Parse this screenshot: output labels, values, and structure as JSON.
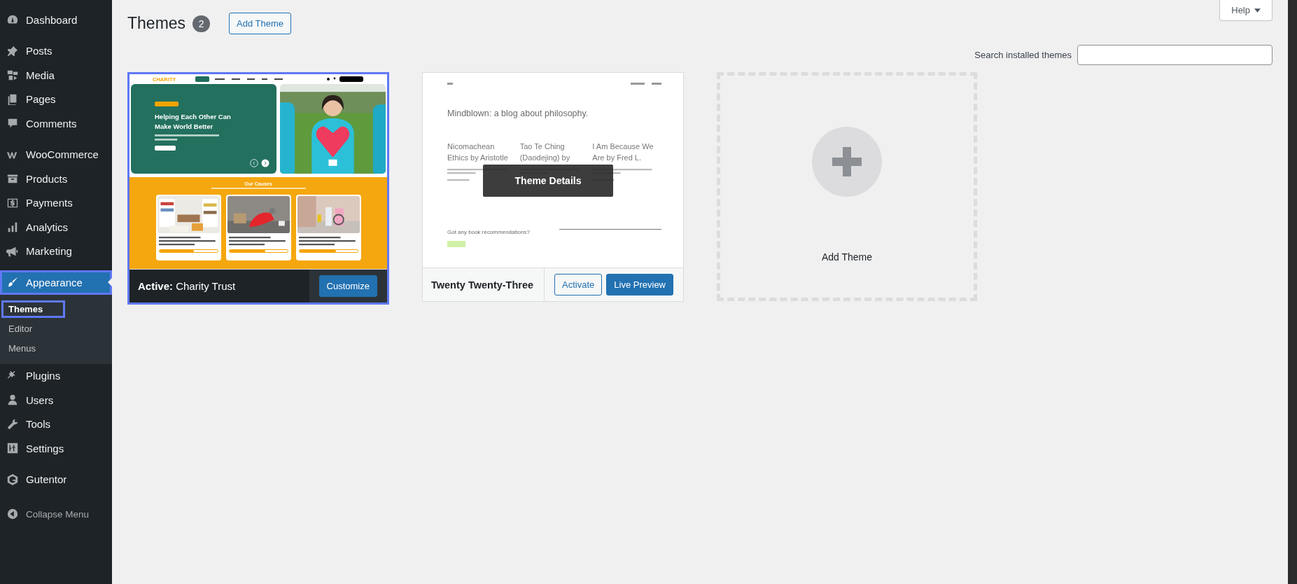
{
  "sidebar": {
    "groups": [
      [
        {
          "label": "Dashboard",
          "selected": false,
          "outlined": false
        }
      ],
      [
        {
          "label": "Posts",
          "selected": false,
          "outlined": false
        },
        {
          "label": "Media",
          "selected": false,
          "outlined": false
        },
        {
          "label": "Pages",
          "selected": false,
          "outlined": false
        },
        {
          "label": "Comments",
          "selected": false,
          "outlined": false
        }
      ],
      [
        {
          "label": "WooCommerce",
          "selected": false,
          "outlined": false
        },
        {
          "label": "Products",
          "selected": false,
          "outlined": false
        },
        {
          "label": "Payments",
          "selected": false,
          "outlined": false
        },
        {
          "label": "Analytics",
          "selected": false,
          "outlined": false
        },
        {
          "label": "Marketing",
          "selected": false,
          "outlined": false
        }
      ],
      [
        {
          "label": "Appearance",
          "selected": true,
          "outlined": true,
          "children": [
            {
              "label": "Themes",
              "selected": true,
              "outlined": true
            },
            {
              "label": "Editor",
              "selected": false,
              "outlined": false
            },
            {
              "label": "Menus",
              "selected": false,
              "outlined": false
            }
          ]
        },
        {
          "label": "Plugins",
          "selected": false,
          "outlined": false
        },
        {
          "label": "Users",
          "selected": false,
          "outlined": false
        },
        {
          "label": "Tools",
          "selected": false,
          "outlined": false
        },
        {
          "label": "Settings",
          "selected": false,
          "outlined": false
        }
      ],
      [
        {
          "label": "Gutentor",
          "selected": false,
          "outlined": false
        }
      ]
    ],
    "collapse": {
      "label": "Collapse Menu"
    }
  },
  "header": {
    "title": "Themes",
    "count": "2",
    "add_button": "Add Theme",
    "help_button": "Help"
  },
  "search": {
    "label": "Search installed themes"
  },
  "themes": [
    {
      "title": "**Active:** Charity Trust",
      "active": true,
      "outlined": true,
      "buttons": [
        {
          "label": "Customize",
          "kind": "primary"
        }
      ],
      "preview": {
        "kind": "charity",
        "logo": "CHARITY",
        "headline": "Helping Each Other Can Make World Better",
        "section_title": "Our Causes",
        "causes": [
          {
            "level": 0.6
          },
          {
            "level": 0.62
          },
          {
            "level": 0.63
          }
        ]
      }
    },
    {
      "title": "Twenty Twenty-Three",
      "active": false,
      "outlined": false,
      "overlay": "Theme Details",
      "buttons": [
        {
          "label": "Activate",
          "kind": "secondary"
        },
        {
          "label": "Live Preview",
          "kind": "primary"
        }
      ],
      "preview": {
        "kind": "tt3",
        "headline": "Mindblown: a blog about philosophy.",
        "posts": [
          {
            "title": "Nicomachean Ethics by Aristotle"
          },
          {
            "title": "Tao Te Ching (Daodejing) by"
          },
          {
            "title": "I Am Because We Are by Fred L."
          }
        ],
        "cta": "Got any book recommendations?"
      }
    }
  ],
  "add_tile": {
    "label": "Add Theme"
  }
}
